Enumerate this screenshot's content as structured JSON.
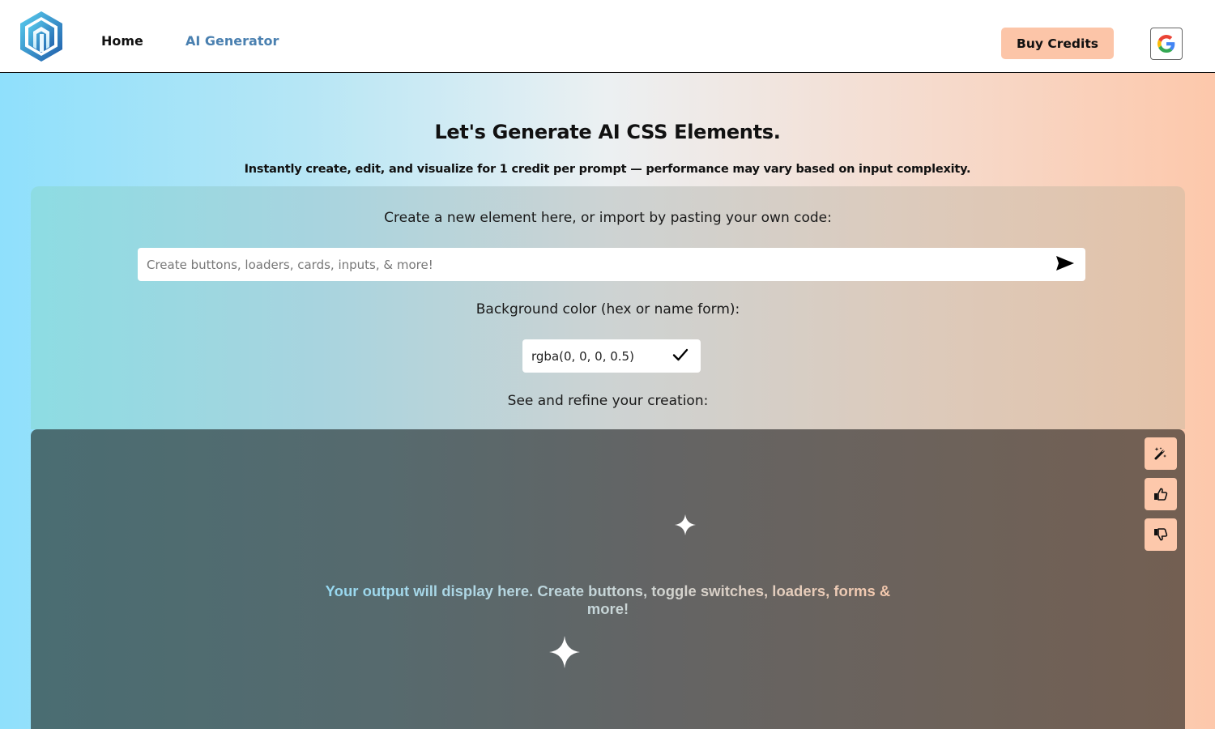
{
  "header": {
    "logo_icon": "hexagon-logo-icon",
    "nav": [
      {
        "label": "Home",
        "active": false
      },
      {
        "label": "AI Generator",
        "active": true
      }
    ],
    "buy_credits_label": "Buy Credits",
    "google_icon": "google-icon"
  },
  "hero": {
    "title": "Let's Generate AI CSS Elements.",
    "subtitle": "Instantly create, edit, and visualize for 1 credit per prompt — performance may vary based on input complexity."
  },
  "panel": {
    "create_label": "Create a new element here, or import by pasting your own code:",
    "prompt_placeholder": "Create buttons, loaders, cards, inputs, & more!",
    "prompt_value": "",
    "send_icon": "send-icon",
    "bg_label": "Background color (hex or name form):",
    "bg_value": "rgba(0, 0, 0, 0.5)",
    "confirm_icon": "checkmark-icon",
    "see_label": "See and refine your creation:"
  },
  "output": {
    "message": "Your output will display here. Create buttons, toggle switches, loaders, forms & more!",
    "tools": [
      {
        "icon": "magic-wand-icon",
        "action": "refine"
      },
      {
        "icon": "thumbs-up-icon",
        "action": "like"
      },
      {
        "icon": "thumbs-down-icon",
        "action": "dislike"
      }
    ]
  },
  "colors": {
    "accent_peach": "#fdc8ab",
    "nav_active": "#4a80b0",
    "gradient_left": "#8fe0fc",
    "gradient_right": "#fdc8ab"
  }
}
